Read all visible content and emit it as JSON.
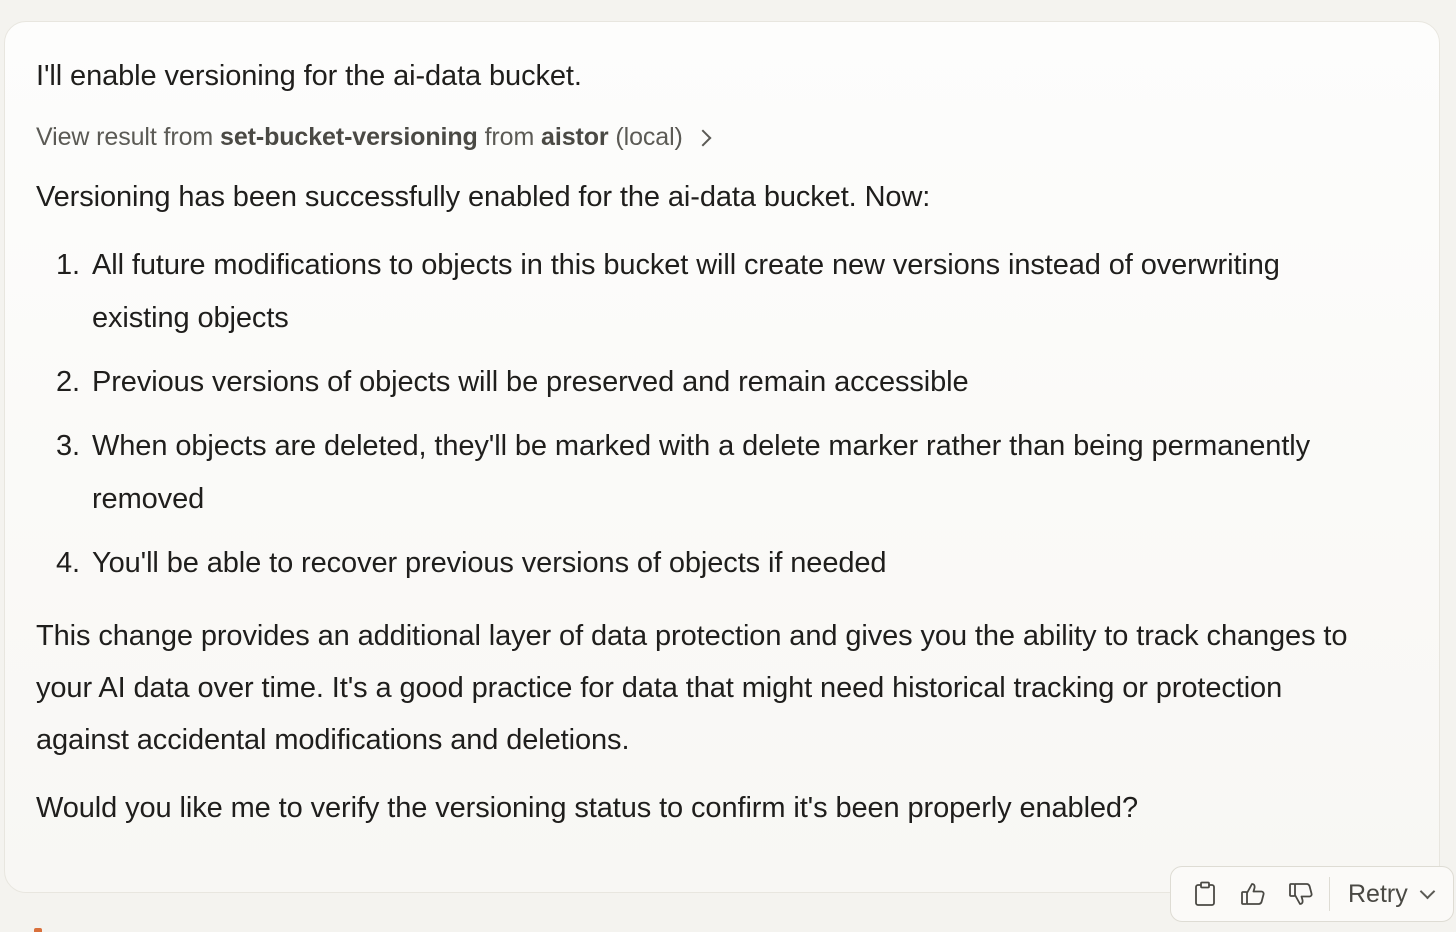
{
  "message": {
    "intro": "I'll enable versioning for the ai-data bucket.",
    "tool_result": {
      "prefix": "View result from",
      "tool_name": "set-bucket-versioning",
      "middle": "from",
      "server_name": "aistor",
      "suffix": "(local)"
    },
    "status": "Versioning has been successfully enabled for the ai-data bucket. Now:",
    "steps": [
      {
        "num": "1.",
        "text": "All future modifications to objects in this bucket will create new versions instead of overwriting existing objects"
      },
      {
        "num": "2.",
        "text": "Previous versions of objects will be preserved and remain accessible"
      },
      {
        "num": "3.",
        "text": "When objects are deleted, they'll be marked with a delete marker rather than being permanently removed"
      },
      {
        "num": "4.",
        "text": "You'll be able to recover previous versions of objects if needed"
      }
    ],
    "summary": "This change provides an additional layer of data protection and gives you the ability to track changes to your AI data over time. It's a good practice for data that might need historical tracking or protection against accidental modifications and deletions.",
    "question": "Would you like me to verify the versioning status to confirm it's been properly enabled?"
  },
  "actions": {
    "copy_icon": "clipboard-icon",
    "like_icon": "thumbs-up-icon",
    "dislike_icon": "thumbs-down-icon",
    "retry_label": "Retry"
  },
  "colors": {
    "background": "#f4f3ef",
    "card": "#fdfdfc",
    "text": "#1f1e1c",
    "muted": "#5b5a55",
    "accent": "#d9703c"
  }
}
